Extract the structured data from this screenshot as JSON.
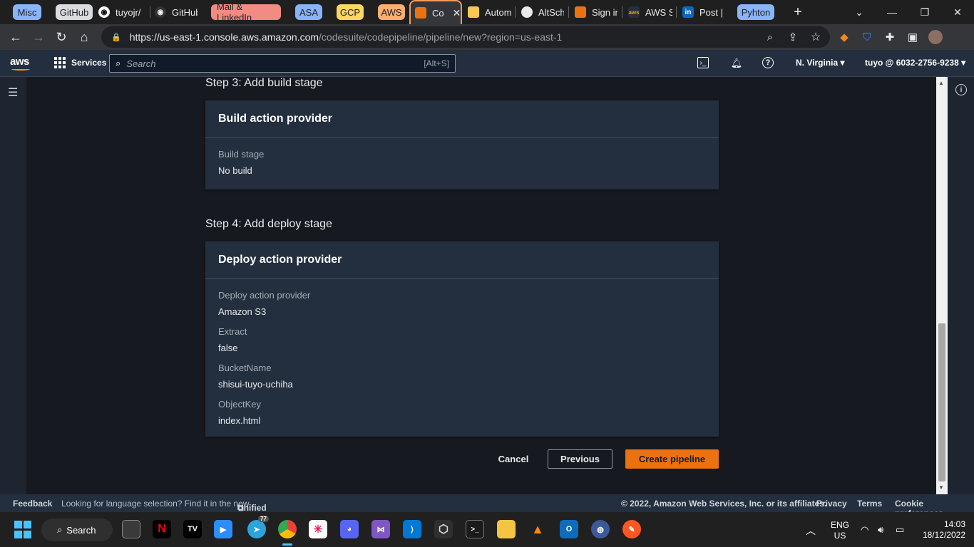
{
  "browser": {
    "tab_groups": [
      {
        "label": "Misc",
        "color": "#8ab4f8"
      },
      {
        "label": "GitHub",
        "color": "#dadce0"
      },
      {
        "label": "Mail & LinkedIn",
        "color": "#f28b82"
      },
      {
        "label": "ASA",
        "color": "#8ab4f8"
      },
      {
        "label": "GCP",
        "color": "#fdd663"
      },
      {
        "label": "AWS",
        "color": "#fcad70"
      },
      {
        "label": "Pyhton",
        "color": "#8ab4f8"
      }
    ],
    "tabs": [
      {
        "label": "tuyojr/"
      },
      {
        "label": "GitHub"
      },
      {
        "label": "Co",
        "active": true
      },
      {
        "label": "Autom"
      },
      {
        "label": "AltSch"
      },
      {
        "label": "Sign in"
      },
      {
        "label": "AWS S"
      },
      {
        "label": "Post |"
      }
    ],
    "url_host": "https://us-east-1.console.aws.amazon.com",
    "url_path": "/codesuite/codepipeline/pipeline/new?region=us-east-1"
  },
  "aws_nav": {
    "logo": "aws",
    "services_label": "Services",
    "search_placeholder": "Search",
    "search_shortcut": "[Alt+S]",
    "region": "N. Virginia",
    "account": "tuyo @ 6032-2756-9238"
  },
  "build": {
    "step_title": "Step 3: Add build stage",
    "panel_title": "Build action provider",
    "fields": [
      {
        "key": "Build stage",
        "value": "No build"
      }
    ]
  },
  "deploy": {
    "step_title": "Step 4: Add deploy stage",
    "panel_title": "Deploy action provider",
    "fields": [
      {
        "key": "Deploy action provider",
        "value": "Amazon S3"
      },
      {
        "key": "Extract",
        "value": "false"
      },
      {
        "key": "BucketName",
        "value": "shisui-tuyo-uchiha"
      },
      {
        "key": "ObjectKey",
        "value": "index.html"
      }
    ]
  },
  "actions": {
    "cancel": "Cancel",
    "previous": "Previous",
    "create": "Create pipeline"
  },
  "footer": {
    "feedback": "Feedback",
    "lang_note": "Looking for language selection? Find it in the new",
    "unified_settings": "Unified Settings",
    "copyright": "© 2022, Amazon Web Services, Inc. or its affiliates.",
    "privacy": "Privacy",
    "terms": "Terms",
    "cookies": "Cookie preferences"
  },
  "taskbar": {
    "search_label": "Search",
    "telegram_badge": "77",
    "lang_top": "ENG",
    "lang_bottom": "US",
    "time": "14:03",
    "date": "18/12/2022"
  },
  "colors": {
    "accent": "#ec7211",
    "nav_bg": "#232f3e",
    "page_bg": "#16191f"
  }
}
